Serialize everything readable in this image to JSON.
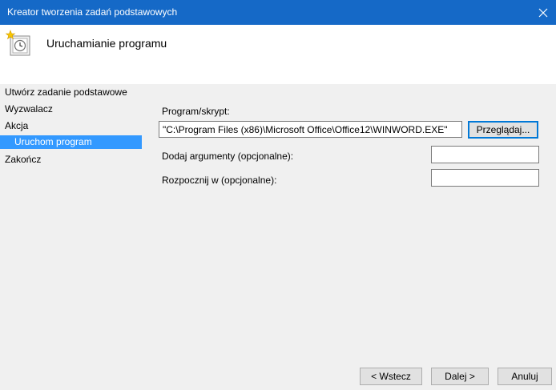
{
  "window": {
    "title": "Kreator tworzenia zadań podstawowych"
  },
  "header": {
    "title": "Uruchamianie programu"
  },
  "nav": {
    "items": [
      {
        "label": "Utwórz zadanie podstawowe"
      },
      {
        "label": "Wyzwalacz"
      },
      {
        "label": "Akcja"
      },
      {
        "label": "Uruchom program"
      },
      {
        "label": "Zakończ"
      }
    ]
  },
  "form": {
    "program_label": "Program/skrypt:",
    "program_value": "\"C:\\Program Files (x86)\\Microsoft Office\\Office12\\WINWORD.EXE\"",
    "browse_label": "Przeglądaj...",
    "args_label": "Dodaj argumenty (opcjonalne):",
    "args_value": "",
    "startin_label": "Rozpocznij w (opcjonalne):",
    "startin_value": ""
  },
  "footer": {
    "back_label": "< Wstecz",
    "next_label": "Dalej >",
    "cancel_label": "Anuluj"
  }
}
